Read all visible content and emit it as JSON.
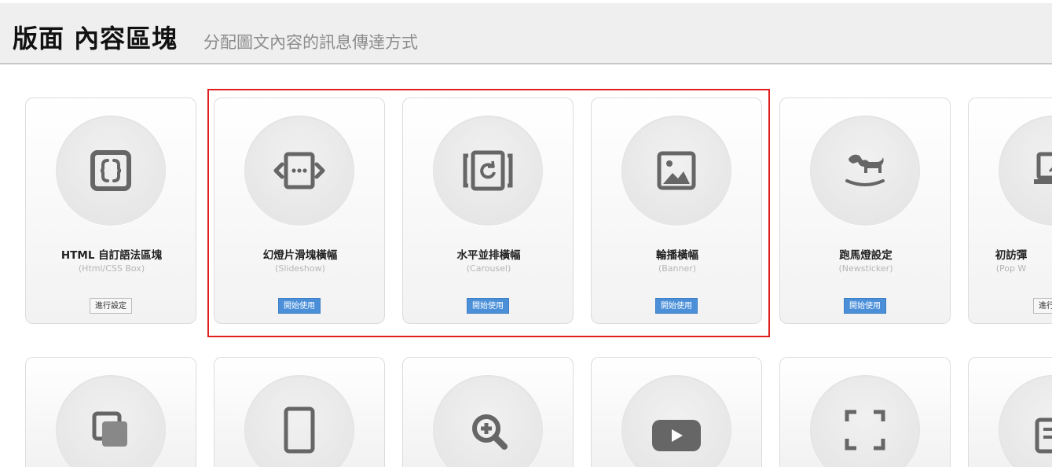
{
  "header": {
    "title": "版面 內容區塊",
    "subtitle": "分配圖文內容的訊息傳達方式"
  },
  "row1": [
    {
      "title": "HTML 自訂語法區塊",
      "subtitle": "(Html/CSS Box)",
      "button": "進行設定",
      "button_type": "secondary",
      "icon": "code-braces-icon"
    },
    {
      "title": "幻燈片滑塊橫幅",
      "subtitle": "(Slideshow)",
      "button": "開始使用",
      "button_type": "primary",
      "icon": "slideshow-icon"
    },
    {
      "title": "水平並排橫幅",
      "subtitle": "(Carousel)",
      "button": "開始使用",
      "button_type": "primary",
      "icon": "carousel-icon"
    },
    {
      "title": "輪播橫幅",
      "subtitle": "(Banner)",
      "button": "開始使用",
      "button_type": "primary",
      "icon": "image-icon"
    },
    {
      "title": "跑馬燈設定",
      "subtitle": "(Newsticker)",
      "button": "開始使用",
      "button_type": "primary",
      "icon": "rocking-horse-icon"
    },
    {
      "title": "初訪彈",
      "subtitle": "(Pop W",
      "button": "進行",
      "button_type": "secondary",
      "icon": "laptop-window-icon"
    }
  ],
  "row2_icons": [
    "stacked-squares-icon",
    "tablet-icon",
    "zoom-in-icon",
    "play-video-icon",
    "fullscreen-icon",
    "list-icon"
  ],
  "colors": {
    "primary_button": "#4a8fd8",
    "highlight": "#e02020",
    "icon": "#666666"
  }
}
